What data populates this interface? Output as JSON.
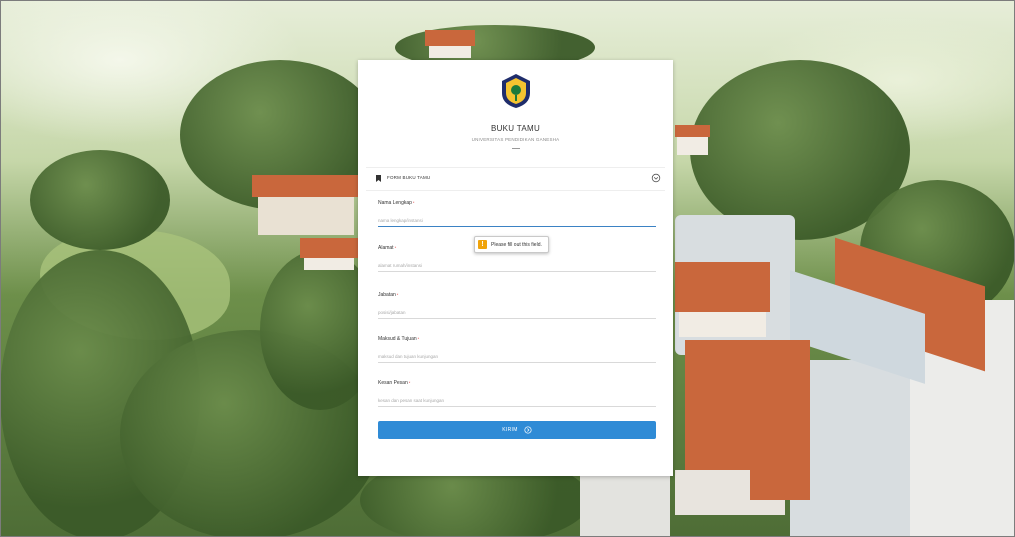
{
  "header": {
    "title": "BUKU TAMU",
    "subtitle": "UNIVERSITAS PENDIDIKAN GANESHA"
  },
  "section": {
    "title": "FORM BUKU TAMU",
    "icon": "bookmark-icon",
    "toggle_icon": "collapse-icon"
  },
  "form": {
    "fields": [
      {
        "label": "Nama Lengkap",
        "required_mark": "*",
        "placeholder": "nama lengkap/instansi",
        "value": ""
      },
      {
        "label": "Alamat",
        "required_mark": "*",
        "placeholder": "alamat rumah/instansi",
        "value": ""
      },
      {
        "label": "Jabatan",
        "required_mark": "*",
        "placeholder": "posisi/jabatan",
        "value": ""
      },
      {
        "label": "Maksud & Tujuan",
        "required_mark": "*",
        "placeholder": "maksud dan tujuan kunjungan",
        "value": ""
      },
      {
        "label": "Kesan Pesan",
        "required_mark": "*",
        "placeholder": "kesan dan pesan saat kunjungan",
        "value": ""
      }
    ],
    "validation_tooltip": {
      "icon": "warning-icon",
      "text": "Please fill out this field."
    },
    "submit": {
      "label": "KIRIM",
      "icon": "arrow-circle-icon"
    }
  },
  "colors": {
    "accent": "#2f8bd6",
    "focus_underline": "#3b82c4",
    "warning": "#f0a30a",
    "roof": "#c9673c"
  }
}
